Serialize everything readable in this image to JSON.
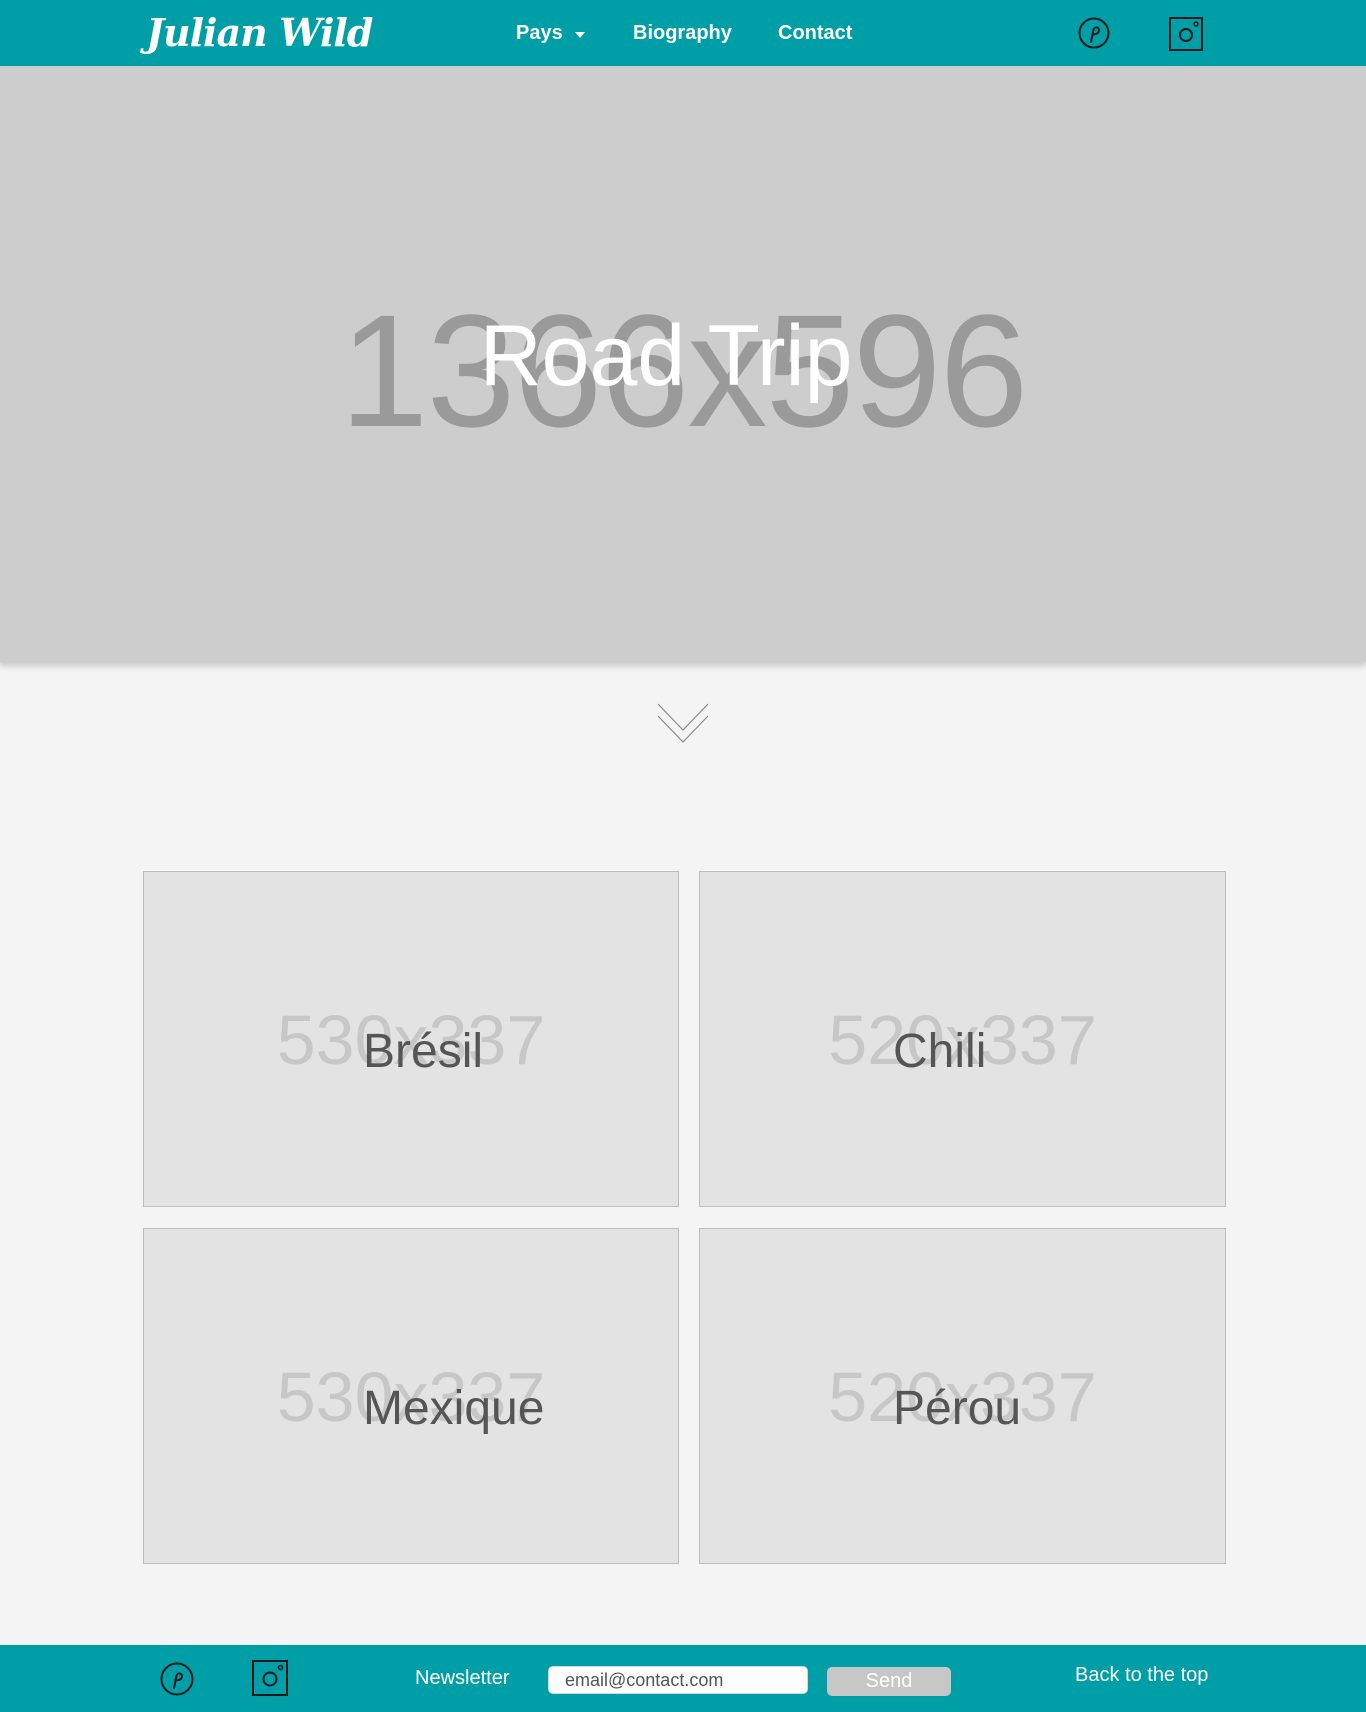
{
  "header": {
    "logo": "Julian Wild",
    "nav": {
      "pays": "Pays",
      "biography": "Biography",
      "contact": "Contact"
    },
    "icons": [
      "pinterest-icon",
      "instagram-icon"
    ]
  },
  "hero": {
    "placeholder": "1366x596",
    "title": "Road Trip"
  },
  "scroll_icon": "chevron-down-icon",
  "cards": [
    {
      "title": "Brésil",
      "placeholder": "530x337"
    },
    {
      "title": "Chili",
      "placeholder": "520x337"
    },
    {
      "title": "Mexique",
      "placeholder": "530x337"
    },
    {
      "title": "Pérou",
      "placeholder": "520x337"
    }
  ],
  "footer": {
    "newsletter_label": "Newsletter",
    "email_value": "email@contact.com",
    "send_label": "Send",
    "back_to_top": "Back to the top",
    "icons": [
      "pinterest-icon",
      "instagram-icon"
    ]
  },
  "colors": {
    "brand": "#009ea6",
    "page_background": "#f4f4f4",
    "placeholder_grey": "#cdcdcd"
  }
}
